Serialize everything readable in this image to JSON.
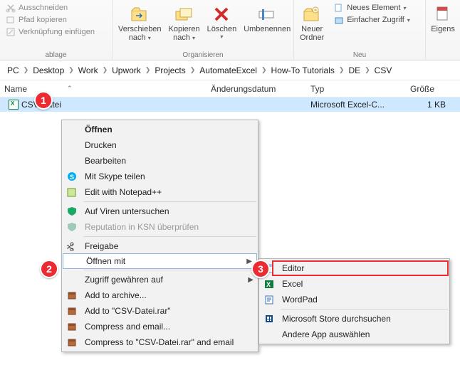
{
  "ribbon": {
    "clipboard": {
      "cut": "Ausschneiden",
      "copy_path": "Pfad kopieren",
      "paste_link": "Verknüpfung einfügen",
      "title": "ablage"
    },
    "organize": {
      "move": "Verschieben nach",
      "copy": "Kopieren nach",
      "delete": "Löschen",
      "rename": "Umbenennen",
      "title": "Organisieren"
    },
    "new": {
      "folder": "Neuer Ordner",
      "item": "Neues Element",
      "easy": "Einfacher Zugriff",
      "title": "Neu"
    },
    "open": {
      "props": "Eigens"
    }
  },
  "breadcrumbs": [
    "PC",
    "Desktop",
    "Work",
    "Upwork",
    "Projects",
    "AutomateExcel",
    "How-To Tutorials",
    "DE",
    "CSV"
  ],
  "columns": {
    "name": "Name",
    "date": "Änderungsdatum",
    "type": "Typ",
    "size": "Größe"
  },
  "row": {
    "name": "CSV-Datei",
    "type": "Microsoft Excel-C...",
    "size": "1 KB"
  },
  "callouts": {
    "c1": "1",
    "c2": "2",
    "c3": "3"
  },
  "ctx": {
    "open": "Öffnen",
    "print": "Drucken",
    "edit": "Bearbeiten",
    "skype": "Mit Skype teilen",
    "npp": "Edit with Notepad++",
    "virus": "Auf Viren untersuchen",
    "ksn": "Reputation in KSN überprüfen",
    "share": "Freigabe",
    "open_with": "Öffnen mit",
    "grant": "Zugriff gewähren auf",
    "archive": "Add to archive...",
    "add_rar": "Add to \"CSV-Datei.rar\"",
    "email": "Compress and email...",
    "email_rar": "Compress to \"CSV-Datei.rar\" and email"
  },
  "ow": {
    "editor": "Editor",
    "excel": "Excel",
    "wordpad": "WordPad",
    "store": "Microsoft Store durchsuchen",
    "other": "Andere App auswählen"
  }
}
